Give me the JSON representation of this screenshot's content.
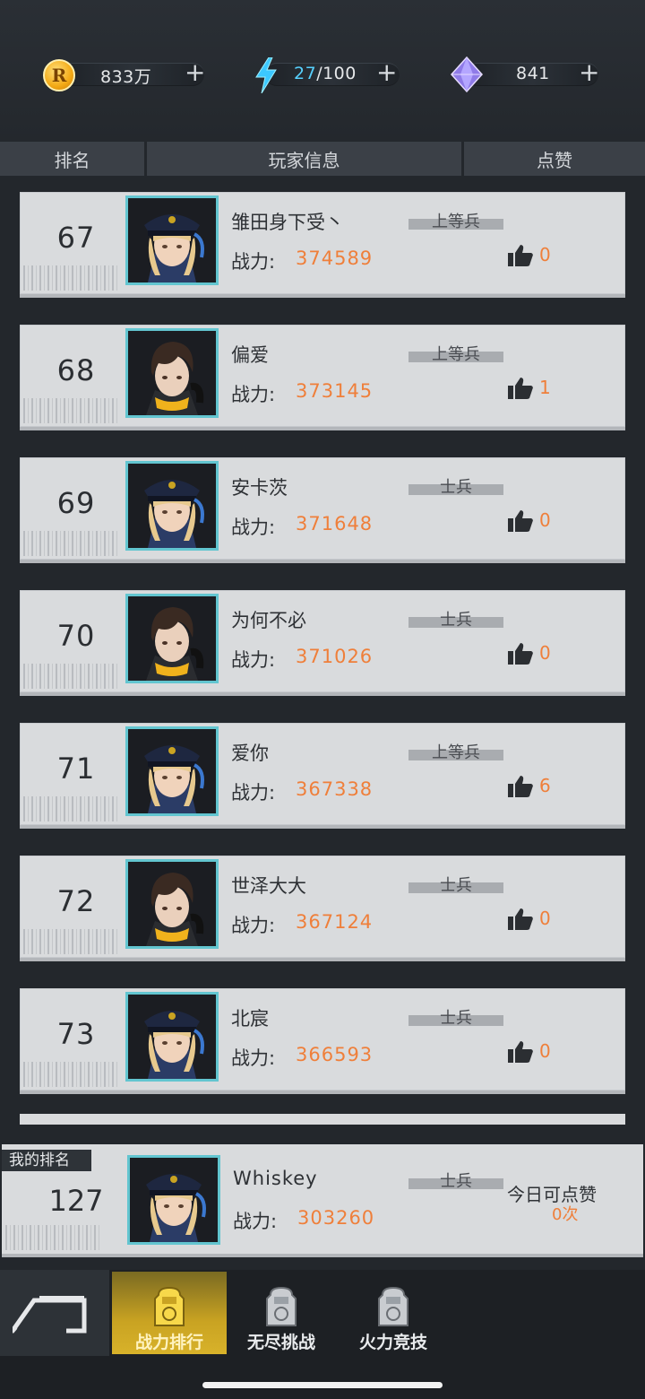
{
  "resources": {
    "gold": {
      "value": "833万",
      "plus": "+"
    },
    "energy": {
      "current": "27",
      "max": "/100",
      "plus": "+"
    },
    "gems": {
      "value": "841",
      "plus": "+"
    }
  },
  "table": {
    "col_rank": "排名",
    "col_player": "玩家信息",
    "col_likes": "点赞"
  },
  "power_label": "战力:",
  "rows": [
    {
      "rank": "67",
      "name": "雏田身下受丶",
      "title": "上等兵",
      "power": "374589",
      "likes": "0",
      "avatar": "officer"
    },
    {
      "rank": "68",
      "name": "偏爱",
      "title": "上等兵",
      "power": "373145",
      "likes": "1",
      "avatar": "brunette"
    },
    {
      "rank": "69",
      "name": "安卡茨",
      "title": "士兵",
      "power": "371648",
      "likes": "0",
      "avatar": "officer"
    },
    {
      "rank": "70",
      "name": "为何不必",
      "title": "士兵",
      "power": "371026",
      "likes": "0",
      "avatar": "brunette"
    },
    {
      "rank": "71",
      "name": "爱你",
      "title": "上等兵",
      "power": "367338",
      "likes": "6",
      "avatar": "officer"
    },
    {
      "rank": "72",
      "name": "世泽大大",
      "title": "士兵",
      "power": "367124",
      "likes": "0",
      "avatar": "brunette"
    },
    {
      "rank": "73",
      "name": "北宸",
      "title": "士兵",
      "power": "366593",
      "likes": "0",
      "avatar": "officer"
    }
  ],
  "mine": {
    "tag": "我的排名",
    "rank": "127",
    "name": "Whiskey",
    "title": "士兵",
    "power": "303260",
    "today_label": "今日可点赞",
    "today_count": "0次"
  },
  "nav": {
    "tabs": [
      {
        "label": "战力排行",
        "active": true
      },
      {
        "label": "无尽挑战",
        "active": false
      },
      {
        "label": "火力竞技",
        "active": false
      }
    ]
  },
  "colors": {
    "accent_orange": "#ef7f3a",
    "energy_cyan": "#57d1ff",
    "active_tab": "#c9a322"
  }
}
